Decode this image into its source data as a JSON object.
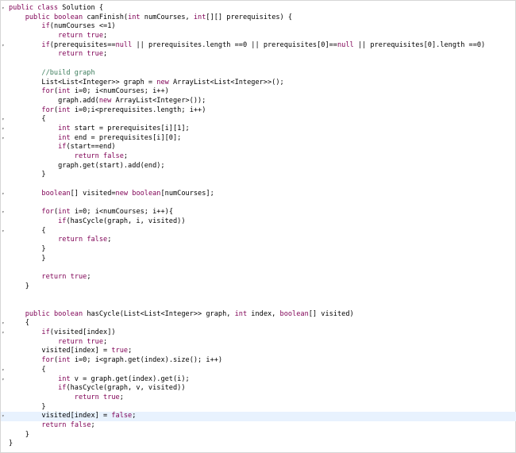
{
  "editor": {
    "language": "java",
    "current_line_index": 44,
    "colors": {
      "keyword": "#7f0055",
      "comment": "#3f7f5f",
      "text": "#000000",
      "current_line_bg": "#e8f2fe"
    },
    "lines": [
      {
        "text": "public class Solution {",
        "fold": true
      },
      {
        "text": "    public boolean canFinish(int numCourses, int[][] prerequisites) {",
        "fold": false
      },
      {
        "text": "        if(numCourses <=1)",
        "fold": false
      },
      {
        "text": "            return true;",
        "fold": false
      },
      {
        "text": "        if(prerequisites==null || prerequisites.length ==0 || prerequisites[0]==null || prerequisites[0].length ==0)",
        "fold": true
      },
      {
        "text": "            return true;",
        "fold": false
      },
      {
        "text": "",
        "fold": false
      },
      {
        "text": "        //build graph",
        "fold": false
      },
      {
        "text": "        List<List<Integer>> graph = new ArrayList<List<Integer>>();",
        "fold": false
      },
      {
        "text": "        for(int i=0; i<numCourses; i++)",
        "fold": false
      },
      {
        "text": "            graph.add(new ArrayList<Integer>());",
        "fold": false
      },
      {
        "text": "        for(int i=0;i<prerequisites.length; i++)",
        "fold": false
      },
      {
        "text": "        {",
        "fold": true
      },
      {
        "text": "            int start = prerequisites[i][1];",
        "fold": true
      },
      {
        "text": "            int end = prerequisites[i][0];",
        "fold": true
      },
      {
        "text": "            if(start==end)",
        "fold": false
      },
      {
        "text": "                return false;",
        "fold": false
      },
      {
        "text": "            graph.get(start).add(end);",
        "fold": false
      },
      {
        "text": "        }",
        "fold": false
      },
      {
        "text": "",
        "fold": false
      },
      {
        "text": "        boolean[] visited=new boolean[numCourses];",
        "fold": true
      },
      {
        "text": "",
        "fold": false
      },
      {
        "text": "        for(int i=0; i<numCourses; i++){",
        "fold": true
      },
      {
        "text": "            if(hasCycle(graph, i, visited))",
        "fold": false
      },
      {
        "text": "        {",
        "fold": true
      },
      {
        "text": "            return false;",
        "fold": false
      },
      {
        "text": "        }",
        "fold": false
      },
      {
        "text": "        }",
        "fold": false
      },
      {
        "text": "",
        "fold": false
      },
      {
        "text": "        return true;",
        "fold": false
      },
      {
        "text": "    }",
        "fold": false
      },
      {
        "text": "",
        "fold": false
      },
      {
        "text": "",
        "fold": false
      },
      {
        "text": "    public boolean hasCycle(List<List<Integer>> graph, int index, boolean[] visited)",
        "fold": false
      },
      {
        "text": "    {",
        "fold": true
      },
      {
        "text": "        if(visited[index])",
        "fold": true
      },
      {
        "text": "            return true;",
        "fold": false
      },
      {
        "text": "        visited[index] = true;",
        "fold": false
      },
      {
        "text": "        for(int i=0; i<graph.get(index).size(); i++)",
        "fold": false
      },
      {
        "text": "        {",
        "fold": true
      },
      {
        "text": "            int v = graph.get(index).get(i);",
        "fold": true
      },
      {
        "text": "            if(hasCycle(graph, v, visited))",
        "fold": false
      },
      {
        "text": "                return true;",
        "fold": false
      },
      {
        "text": "        }",
        "fold": false
      },
      {
        "text": "        visited[index] = false;",
        "fold": true
      },
      {
        "text": "        return false;",
        "fold": false
      },
      {
        "text": "    }",
        "fold": false
      },
      {
        "text": "}",
        "fold": false
      }
    ]
  }
}
